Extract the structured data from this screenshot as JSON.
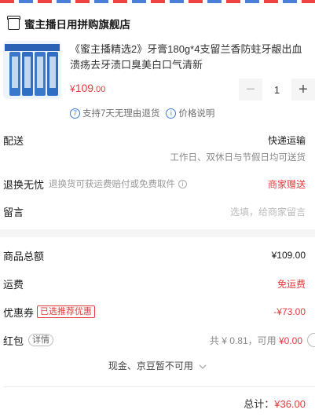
{
  "shop": {
    "name": "蜜主播日用拼购旗舰店"
  },
  "product": {
    "title_line1": "《蜜主播精选2》牙膏180g*4支留兰香防蛀牙龈出血",
    "title_line2": "溃疡去牙渍口臭美白口气清新",
    "price_symbol": "¥",
    "price_int": "109",
    "price_dec": ".00",
    "quantity": "1",
    "minus": "−",
    "plus": "+",
    "badge_num": "7",
    "return_policy": "支持7天无理由退货",
    "price_info_icon": "i",
    "price_note": "价格说明"
  },
  "delivery": {
    "label": "配送",
    "value": "快递运输",
    "sub": "工作日、双休日与节假日均可送货"
  },
  "returns": {
    "label": "退换无忧",
    "hint": "退换货可获运费赔付或免费取件",
    "info_icon": "i",
    "value": "商家赠送"
  },
  "message": {
    "label": "留言",
    "placeholder": "选填，给商家留言"
  },
  "summary": {
    "subtotal_label": "商品总额",
    "subtotal": "¥109.00",
    "shipping_label": "运费",
    "shipping": "免运费",
    "coupon_label": "优惠券",
    "coupon_tag": "已选推荐优惠",
    "coupon_value": "-¥73.00",
    "redpack_label": "红包",
    "redpack_detail": "详情",
    "redpack_available": "共 ¥ 0.81，可用",
    "redpack_value": "¥0.00",
    "cash_note": "现金、京豆暂不可用",
    "total_label": "总计：",
    "total_value": "¥36.00"
  },
  "colors": {
    "accent": "#e4393c",
    "info_blue": "#3b7ce0"
  },
  "icons": {
    "shop": "store-icon",
    "chevron": "chevron-down-icon"
  }
}
